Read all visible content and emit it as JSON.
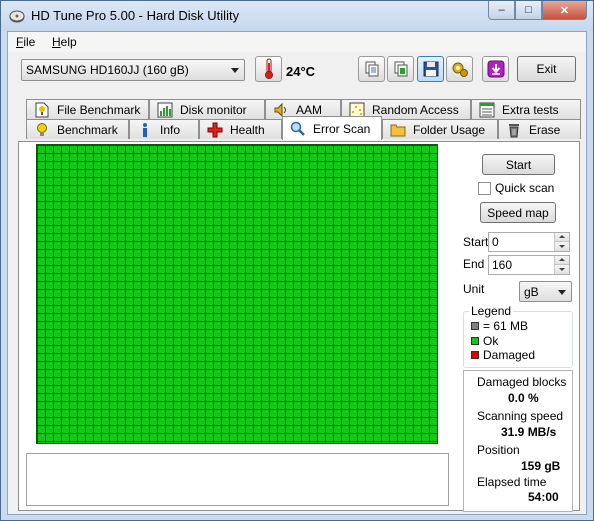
{
  "window": {
    "title": "HD Tune Pro 5.00 - Hard Disk Utility",
    "controls": [
      "–",
      "□",
      "✕"
    ]
  },
  "menu": {
    "file": {
      "accel": "F",
      "rest": "ile"
    },
    "help": {
      "accel": "H",
      "rest": "elp"
    }
  },
  "toolbar": {
    "drive": "SAMSUNG HD160JJ (160 gB)",
    "temperature": "24°C",
    "exit_label": "Exit",
    "icons": [
      "copy-icon",
      "copy-all-icon",
      "save-icon",
      "options-icon",
      "download-icon"
    ]
  },
  "tabs": {
    "top_row": [
      {
        "label": "File Benchmark",
        "icon": "file-benchmark-icon"
      },
      {
        "label": "Disk monitor",
        "icon": "disk-monitor-icon"
      },
      {
        "label": "AAM",
        "icon": "aam-icon"
      },
      {
        "label": "Random Access",
        "icon": "random-access-icon"
      },
      {
        "label": "Extra tests",
        "icon": "extra-tests-icon"
      }
    ],
    "bottom_row": [
      {
        "label": "Benchmark",
        "icon": "benchmark-icon"
      },
      {
        "label": "Info",
        "icon": "info-icon"
      },
      {
        "label": "Health",
        "icon": "health-icon"
      },
      {
        "label": "Error Scan",
        "icon": "error-scan-icon",
        "selected": true
      },
      {
        "label": "Folder Usage",
        "icon": "folder-usage-icon"
      },
      {
        "label": "Erase",
        "icon": "erase-icon"
      }
    ]
  },
  "scan": {
    "start_button": "Start",
    "quick_scan_label": "Quick scan",
    "quick_scan_checked": false,
    "speed_map_button": "Speed map",
    "start_label": "Start",
    "start_value": "0",
    "end_label": "End",
    "end_value": "160",
    "unit_label": "Unit",
    "unit_value": "gB",
    "block_status": "ok",
    "colors": {
      "ok": "#14c81a",
      "damaged": "#e00000",
      "block": "#808080"
    }
  },
  "legend": {
    "title": "Legend",
    "block_size": "= 61 MB",
    "ok": "Ok",
    "damaged": "Damaged"
  },
  "stats": {
    "damaged_blocks_label": "Damaged blocks",
    "damaged_blocks_value": "0.0 %",
    "scanning_speed_label": "Scanning speed",
    "scanning_speed_value": "31.9 MB/s",
    "position_label": "Position",
    "position_value": "159 gB",
    "elapsed_label": "Elapsed time",
    "elapsed_value": "54:00"
  }
}
